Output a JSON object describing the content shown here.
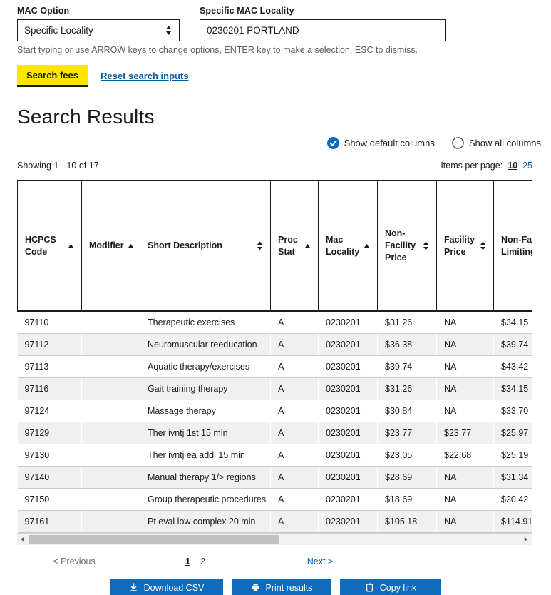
{
  "search_form": {
    "mac_option": {
      "label": "MAC Option",
      "value": "Specific Locality",
      "icon": "updown-arrows-icon"
    },
    "specific_mac_locality": {
      "label": "Specific MAC Locality",
      "value": "0230201 PORTLAND",
      "placeholder": ""
    },
    "helper_text": "Start typing or use ARROW keys to change options, ENTER key to make a selection, ESC to dismiss.",
    "search_button": "Search fees",
    "reset_link": "Reset search inputs",
    "accent_yellow": "#ffe500",
    "link_blue": "#005ea2"
  },
  "results": {
    "title": "Search Results",
    "column_toggle": {
      "default_label": "Show default columns",
      "all_label": "Show all columns",
      "selected": "default",
      "selected_color": "#0b6cbd"
    },
    "showing_text": "Showing 1 - 10 of 17",
    "items_per_page": {
      "label": "Items per page:",
      "options": [
        "10",
        "25"
      ],
      "selected": "10"
    }
  },
  "table": {
    "columns": [
      {
        "label": "HCPCS Code",
        "sort": "asc"
      },
      {
        "label": "Modifier",
        "sort": "asc"
      },
      {
        "label": "Short Description",
        "sort": "both"
      },
      {
        "label": "Proc Stat",
        "sort": "asc"
      },
      {
        "label": "Mac Locality",
        "sort": "asc"
      },
      {
        "label": "Non-Facility Price",
        "sort": "both"
      },
      {
        "label": "Facility Price",
        "sort": "both"
      },
      {
        "label": "Non-Facility Limiting Charge",
        "sort": "none"
      }
    ],
    "rows": [
      {
        "hcpcs": "97110",
        "modifier": "",
        "description": "Therapeutic exercises",
        "proc_stat": "A",
        "mac_locality": "0230201",
        "non_facility_price": "$31.26",
        "facility_price": "NA",
        "non_facility_limiting_charge": "$34.15"
      },
      {
        "hcpcs": "97112",
        "modifier": "",
        "description": "Neuromuscular reeducation",
        "proc_stat": "A",
        "mac_locality": "0230201",
        "non_facility_price": "$36.38",
        "facility_price": "NA",
        "non_facility_limiting_charge": "$39.74"
      },
      {
        "hcpcs": "97113",
        "modifier": "",
        "description": "Aquatic therapy/exercises",
        "proc_stat": "A",
        "mac_locality": "0230201",
        "non_facility_price": "$39.74",
        "facility_price": "NA",
        "non_facility_limiting_charge": "$43.42"
      },
      {
        "hcpcs": "97116",
        "modifier": "",
        "description": "Gait training therapy",
        "proc_stat": "A",
        "mac_locality": "0230201",
        "non_facility_price": "$31.26",
        "facility_price": "NA",
        "non_facility_limiting_charge": "$34.15"
      },
      {
        "hcpcs": "97124",
        "modifier": "",
        "description": "Massage therapy",
        "proc_stat": "A",
        "mac_locality": "0230201",
        "non_facility_price": "$30.84",
        "facility_price": "NA",
        "non_facility_limiting_charge": "$33.70"
      },
      {
        "hcpcs": "97129",
        "modifier": "",
        "description": "Ther ivntj 1st 15 min",
        "proc_stat": "A",
        "mac_locality": "0230201",
        "non_facility_price": "$23.77",
        "facility_price": "$23.77",
        "non_facility_limiting_charge": "$25.97"
      },
      {
        "hcpcs": "97130",
        "modifier": "",
        "description": "Ther ivntj ea addl 15 min",
        "proc_stat": "A",
        "mac_locality": "0230201",
        "non_facility_price": "$23.05",
        "facility_price": "$22.68",
        "non_facility_limiting_charge": "$25.19"
      },
      {
        "hcpcs": "97140",
        "modifier": "",
        "description": "Manual therapy 1/> regions",
        "proc_stat": "A",
        "mac_locality": "0230201",
        "non_facility_price": "$28.69",
        "facility_price": "NA",
        "non_facility_limiting_charge": "$31.34"
      },
      {
        "hcpcs": "97150",
        "modifier": "",
        "description": "Group therapeutic procedures",
        "proc_stat": "A",
        "mac_locality": "0230201",
        "non_facility_price": "$18.69",
        "facility_price": "NA",
        "non_facility_limiting_charge": "$20.42"
      },
      {
        "hcpcs": "97161",
        "modifier": "",
        "description": "Pt eval low complex 20 min",
        "proc_stat": "A",
        "mac_locality": "0230201",
        "non_facility_price": "$105.18",
        "facility_price": "NA",
        "non_facility_limiting_charge": "$114.91"
      }
    ]
  },
  "pagination": {
    "previous": "< Previous",
    "pages": [
      "1",
      "2"
    ],
    "current_page": "1",
    "next": "Next >"
  },
  "bottom_actions": {
    "download_csv": {
      "label": "Download CSV",
      "icon": "download-icon"
    },
    "print_results": {
      "label": "Print results",
      "icon": "printer-icon"
    },
    "copy_link": {
      "label": "Copy link",
      "icon": "clipboard-icon"
    },
    "button_blue": "#0f6cbd"
  }
}
